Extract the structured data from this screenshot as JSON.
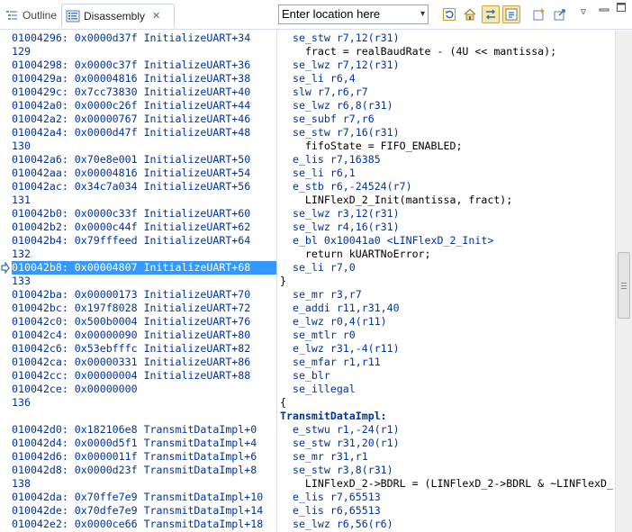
{
  "tabs": {
    "outline_label": "Outline",
    "disassembly_label": "Disassembly",
    "close_glyph": "✕"
  },
  "toolbar": {
    "location_placeholder": "Enter location here",
    "dropdown_glyph": "▾",
    "icons": [
      "refresh-icon",
      "home-icon",
      "link-with-editor-icon",
      "sync-icon",
      "open-new-view-icon",
      "export-icon"
    ],
    "menu_glyph": "▽",
    "minimize_glyph": "▭"
  },
  "rows": [
    {
      "addr": "01004296: 0x0000d37f InitializeUART+34",
      "src": "  se_stw r7,12(r31)",
      "kind": "kw"
    },
    {
      "addr": "129",
      "src": "    fract = realBaudRate - (4U << mantissa);",
      "kind": "plain"
    },
    {
      "addr": "01004298: 0x0000c37f InitializeUART+36",
      "src": "  se_lwz r7,12(r31)",
      "kind": "kw"
    },
    {
      "addr": "0100429a: 0x00004816 InitializeUART+38",
      "src": "  se_li r6,4",
      "kind": "kw"
    },
    {
      "addr": "0100429c: 0x7cc73830 InitializeUART+40",
      "src": "  slw r7,r6,r7",
      "kind": "kw"
    },
    {
      "addr": "010042a0: 0x0000c26f InitializeUART+44",
      "src": "  se_lwz r6,8(r31)",
      "kind": "kw"
    },
    {
      "addr": "010042a2: 0x00000767 InitializeUART+46",
      "src": "  se_subf r7,r6",
      "kind": "kw"
    },
    {
      "addr": "010042a4: 0x0000d47f InitializeUART+48",
      "src": "  se_stw r7,16(r31)",
      "kind": "kw"
    },
    {
      "addr": "130",
      "src": "    fifoState = FIFO_ENABLED;",
      "kind": "plain"
    },
    {
      "addr": "010042a6: 0x70e8e001 InitializeUART+50",
      "src": "  e_lis r7,16385",
      "kind": "kw"
    },
    {
      "addr": "010042aa: 0x00004816 InitializeUART+54",
      "src": "  se_li r6,1",
      "kind": "kw"
    },
    {
      "addr": "010042ac: 0x34c7a034 InitializeUART+56",
      "src": "  e_stb r6,-24524(r7)",
      "kind": "kw"
    },
    {
      "addr": "131",
      "src": "    LINFlexD_2_Init(mantissa, fract);",
      "kind": "plain"
    },
    {
      "addr": "010042b0: 0x0000c33f InitializeUART+60",
      "src": "  se_lwz r3,12(r31)",
      "kind": "kw"
    },
    {
      "addr": "010042b2: 0x0000c44f InitializeUART+62",
      "src": "  se_lwz r4,16(r31)",
      "kind": "kw"
    },
    {
      "addr": "010042b4: 0x79fffeed InitializeUART+64",
      "src": "  e_bl 0x10041a0 <LINFlexD_2_Init>",
      "kind": "kw"
    },
    {
      "addr": "132",
      "src": "    return kUARTNoError;",
      "kind": "plain"
    },
    {
      "addr": "010042b8: 0x00004807 InitializeUART+68",
      "src": "  se_li r7,0",
      "kind": "kw",
      "current": true
    },
    {
      "addr": "133",
      "src": "}",
      "kind": "plain"
    },
    {
      "addr": "010042ba: 0x00000173 InitializeUART+70",
      "src": "  se_mr r3,r7",
      "kind": "kw"
    },
    {
      "addr": "010042bc: 0x197f8028 InitializeUART+72",
      "src": "  e_addi r11,r31,40",
      "kind": "kw"
    },
    {
      "addr": "010042c0: 0x500b0004 InitializeUART+76",
      "src": "  e_lwz r0,4(r11)",
      "kind": "kw"
    },
    {
      "addr": "010042c4: 0x00000090 InitializeUART+80",
      "src": "  se_mtlr r0",
      "kind": "kw"
    },
    {
      "addr": "010042c6: 0x53ebfffc InitializeUART+82",
      "src": "  e_lwz r31,-4(r11)",
      "kind": "kw"
    },
    {
      "addr": "010042ca: 0x00000331 InitializeUART+86",
      "src": "  se_mfar r1,r11",
      "kind": "kw"
    },
    {
      "addr": "010042cc: 0x00000004 InitializeUART+88",
      "src": "  se_blr",
      "kind": "kw"
    },
    {
      "addr": "010042ce: 0x00000000",
      "src": "  se_illegal",
      "kind": "kw"
    },
    {
      "addr": "136",
      "src": "{",
      "kind": "plain"
    },
    {
      "addr": "",
      "src": "TransmitDataImpl:",
      "kind": "bold"
    },
    {
      "addr": "010042d0: 0x182106e8 TransmitDataImpl+0",
      "src": "  e_stwu r1,-24(r1)",
      "kind": "kw"
    },
    {
      "addr": "010042d4: 0x0000d5f1 TransmitDataImpl+4",
      "src": "  se_stw r31,20(r1)",
      "kind": "kw"
    },
    {
      "addr": "010042d6: 0x0000011f TransmitDataImpl+6",
      "src": "  se_mr r31,r1",
      "kind": "kw"
    },
    {
      "addr": "010042d8: 0x0000d23f TransmitDataImpl+8",
      "src": "  se_stw r3,8(r31)",
      "kind": "kw"
    },
    {
      "addr": "138",
      "src": "    LINFlexD_2->BDRL = (LINFlexD_2->BDRL & ~LINFlexD_",
      "kind": "plain"
    },
    {
      "addr": "010042da: 0x70ffe7e9 TransmitDataImpl+10",
      "src": "  e_lis r7,65513",
      "kind": "kw"
    },
    {
      "addr": "010042de: 0x70dfe7e9 TransmitDataImpl+14",
      "src": "  e_lis r6,65513",
      "kind": "kw"
    },
    {
      "addr": "010042e2: 0x0000ce66 TransmitDataImpl+18",
      "src": "  se_lwz r6,56(r6)",
      "kind": "kw"
    }
  ]
}
